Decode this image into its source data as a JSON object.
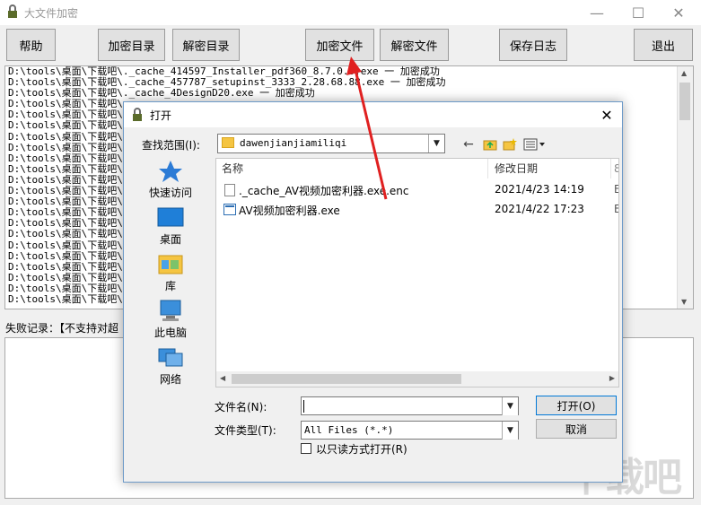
{
  "window": {
    "title": "大文件加密",
    "minimize": "—",
    "maximize": "☐",
    "close": "✕"
  },
  "toolbar": {
    "help": "帮助",
    "encrypt_dir": "加密目录",
    "decrypt_dir": "解密目录",
    "encrypt_file": "加密文件",
    "decrypt_file": "解密文件",
    "save_log": "保存日志",
    "exit": "退出"
  },
  "log": {
    "lines": [
      "D:\\tools\\桌面\\下载吧\\._cache_414597_Installer_pdf360_8.7.0.0.exe 一 加密成功",
      "D:\\tools\\桌面\\下载吧\\._cache_457787_setupinst_3333_2.28.68.88.exe 一 加密成功",
      "D:\\tools\\桌面\\下载吧\\._cache_4DesignD20.exe 一 加密成功",
      "D:\\tools\\桌面\\下载吧\\",
      "D:\\tools\\桌面\\下载吧\\",
      "D:\\tools\\桌面\\下载吧\\",
      "D:\\tools\\桌面\\下载吧\\",
      "D:\\tools\\桌面\\下载吧\\",
      "D:\\tools\\桌面\\下载吧\\",
      "D:\\tools\\桌面\\下载吧\\",
      "D:\\tools\\桌面\\下载吧\\",
      "D:\\tools\\桌面\\下载吧\\",
      "D:\\tools\\桌面\\下载吧\\",
      "D:\\tools\\桌面\\下载吧\\",
      "D:\\tools\\桌面\\下载吧\\",
      "D:\\tools\\桌面\\下载吧\\",
      "D:\\tools\\桌面\\下载吧\\",
      "D:\\tools\\桌面\\下载吧\\",
      "D:\\tools\\桌面\\下载吧\\",
      "D:\\tools\\桌面\\下载吧\\",
      "D:\\tools\\桌面\\下载吧\\",
      "D:\\tools\\桌面\\下载吧\\"
    ]
  },
  "fail": {
    "label": "失败记录：【不支持对超"
  },
  "dialog": {
    "title": "打开",
    "close": "✕",
    "lookin_label": "查找范围(I):",
    "lookin_value": "dawenjianjiamiliqi",
    "nav_back": "←",
    "places": [
      "快速访问",
      "桌面",
      "库",
      "此电脑",
      "网络"
    ],
    "columns": {
      "name": "名称",
      "modified": "修改日期",
      "extra": "8"
    },
    "files": [
      {
        "name": "._cache_AV视频加密利器.exe.enc",
        "date": "2021/4/23 14:19",
        "extra": "E"
      },
      {
        "name": "AV视频加密利器.exe",
        "date": "2021/4/22 17:23",
        "extra": "E"
      }
    ],
    "filename_label": "文件名(N):",
    "filename_value": "",
    "filetype_label": "文件类型(T):",
    "filetype_value": "All Files (*.*)",
    "readonly_label": "以只读方式打开(R)",
    "open_button": "打开(O)",
    "cancel_button": "取消"
  },
  "watermark": "下载吧",
  "colors": {
    "accent": "#0078d7",
    "arrow": "#e02020"
  }
}
